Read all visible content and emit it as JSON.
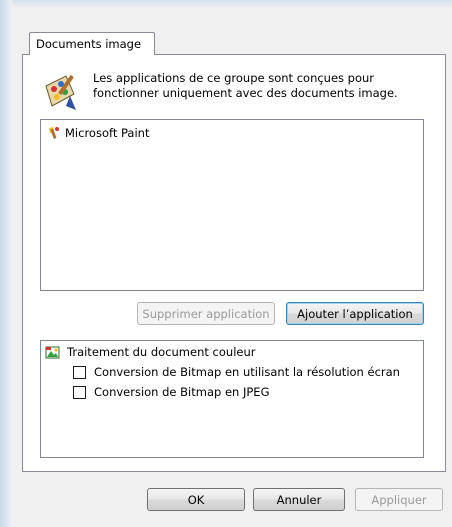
{
  "tab": {
    "label": "Documents image"
  },
  "description": "Les applications de ce groupe sont conçues pour\nfonctionner uniquement avec des documents image.",
  "applications": [
    {
      "label": "Microsoft Paint",
      "icon": "paint-brush-icon"
    }
  ],
  "buttons": {
    "remove": "Supprimer application",
    "add": "Ajouter l’application",
    "ok": "OK",
    "cancel": "Annuler",
    "apply": "Appliquer"
  },
  "processing": {
    "title": "Traitement du document couleur",
    "options": [
      {
        "label": "Conversion de Bitmap en utilisant la résolution écran",
        "checked": false
      },
      {
        "label": "Conversion de Bitmap en JPEG",
        "checked": false
      }
    ]
  }
}
